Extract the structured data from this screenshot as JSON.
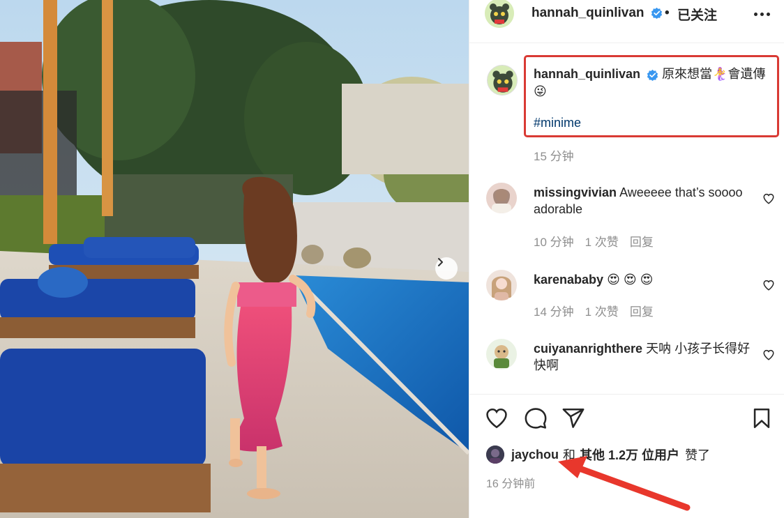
{
  "post": {
    "author": "hannah_quinlivan",
    "follow_status": "已关注",
    "separator": "•",
    "caption_text": "原來想當🧜‍♀會遺傳😜",
    "hashtag": "#minime",
    "caption_time": "15 分钟",
    "posted_ago": "16 分钟前"
  },
  "comments": [
    {
      "user": "missingvivian",
      "text": "Aweeeee that’s soooo adorable",
      "time": "10 分钟",
      "likes": "1 次赞",
      "reply": "回复"
    },
    {
      "user": "karenababy",
      "text": "😍 😍 😍",
      "time": "14 分钟",
      "likes": "1 次赞",
      "reply": "回复"
    },
    {
      "user": "cuiyananrighthere",
      "text": "天呐 小孩子长得好快啊"
    }
  ],
  "likes": {
    "first_user": "jaychou",
    "joiner": "和",
    "others": "其他 1.2万 位用户",
    "suffix": "赞了"
  },
  "icons": {
    "verified": "verified-badge-icon",
    "like": "heart-icon",
    "comment": "comment-bubble-icon",
    "share": "paper-plane-icon",
    "save": "bookmark-icon",
    "next": "chevron-right-icon",
    "more": "more-options-icon"
  },
  "colors": {
    "highlight_border": "#d93a34",
    "verified_blue": "#3897f0",
    "hashtag": "#00376b",
    "muted": "#8e8e8e",
    "annotation_arrow": "#e8372c"
  }
}
